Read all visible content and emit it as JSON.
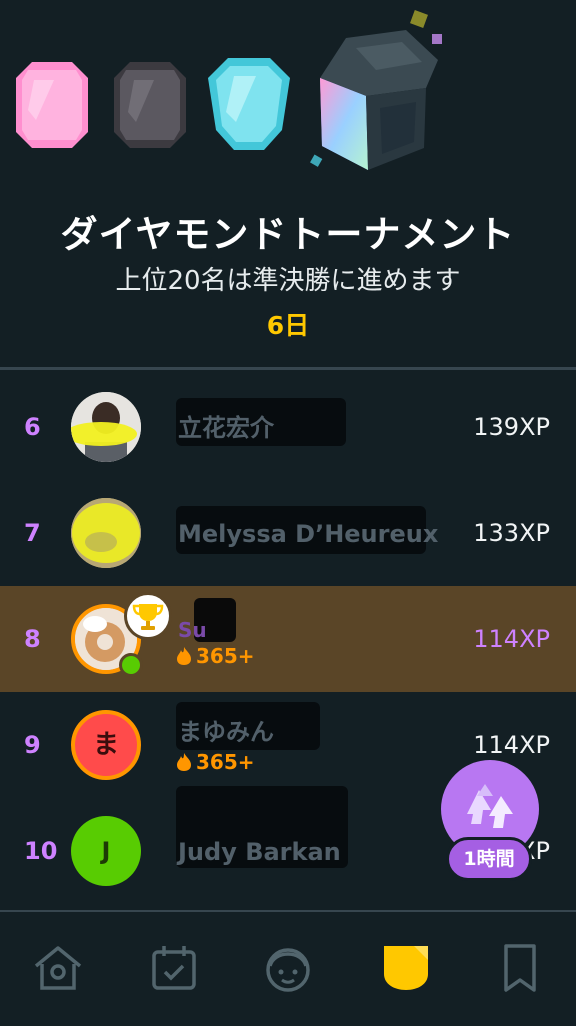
{
  "league": {
    "title": "ダイヤモンドトーナメント",
    "subtitle": "上位20名は準決勝に進めます",
    "days_left": "6日"
  },
  "leaderboard": [
    {
      "rank": "6",
      "name": "立花宏介",
      "xp": "139XP",
      "streak": ""
    },
    {
      "rank": "7",
      "name": "Melyssa D’Heureux",
      "xp": "133XP",
      "streak": ""
    },
    {
      "rank": "8",
      "name": "Su",
      "xp": "114XP",
      "streak": "365+",
      "is_current_user": true
    },
    {
      "rank": "9",
      "name": "まゆみん",
      "xp": "114XP",
      "streak": "365+",
      "avatar_letter": "ま"
    },
    {
      "rank": "10",
      "name": "Judy Barkan",
      "xp": "XP",
      "streak": "",
      "avatar_letter": "J"
    }
  ],
  "boost": {
    "timer_label": "1時間"
  },
  "nav": {
    "items": [
      "home-icon",
      "calendar-icon",
      "character-icon",
      "league-shield-icon",
      "bookmark-icon"
    ]
  },
  "colors": {
    "background": "#131f24",
    "accent_purple": "#ce82ff",
    "accent_gold": "#ffc800",
    "streak_orange": "#ff9600",
    "highlight_row": "#5a4527"
  }
}
